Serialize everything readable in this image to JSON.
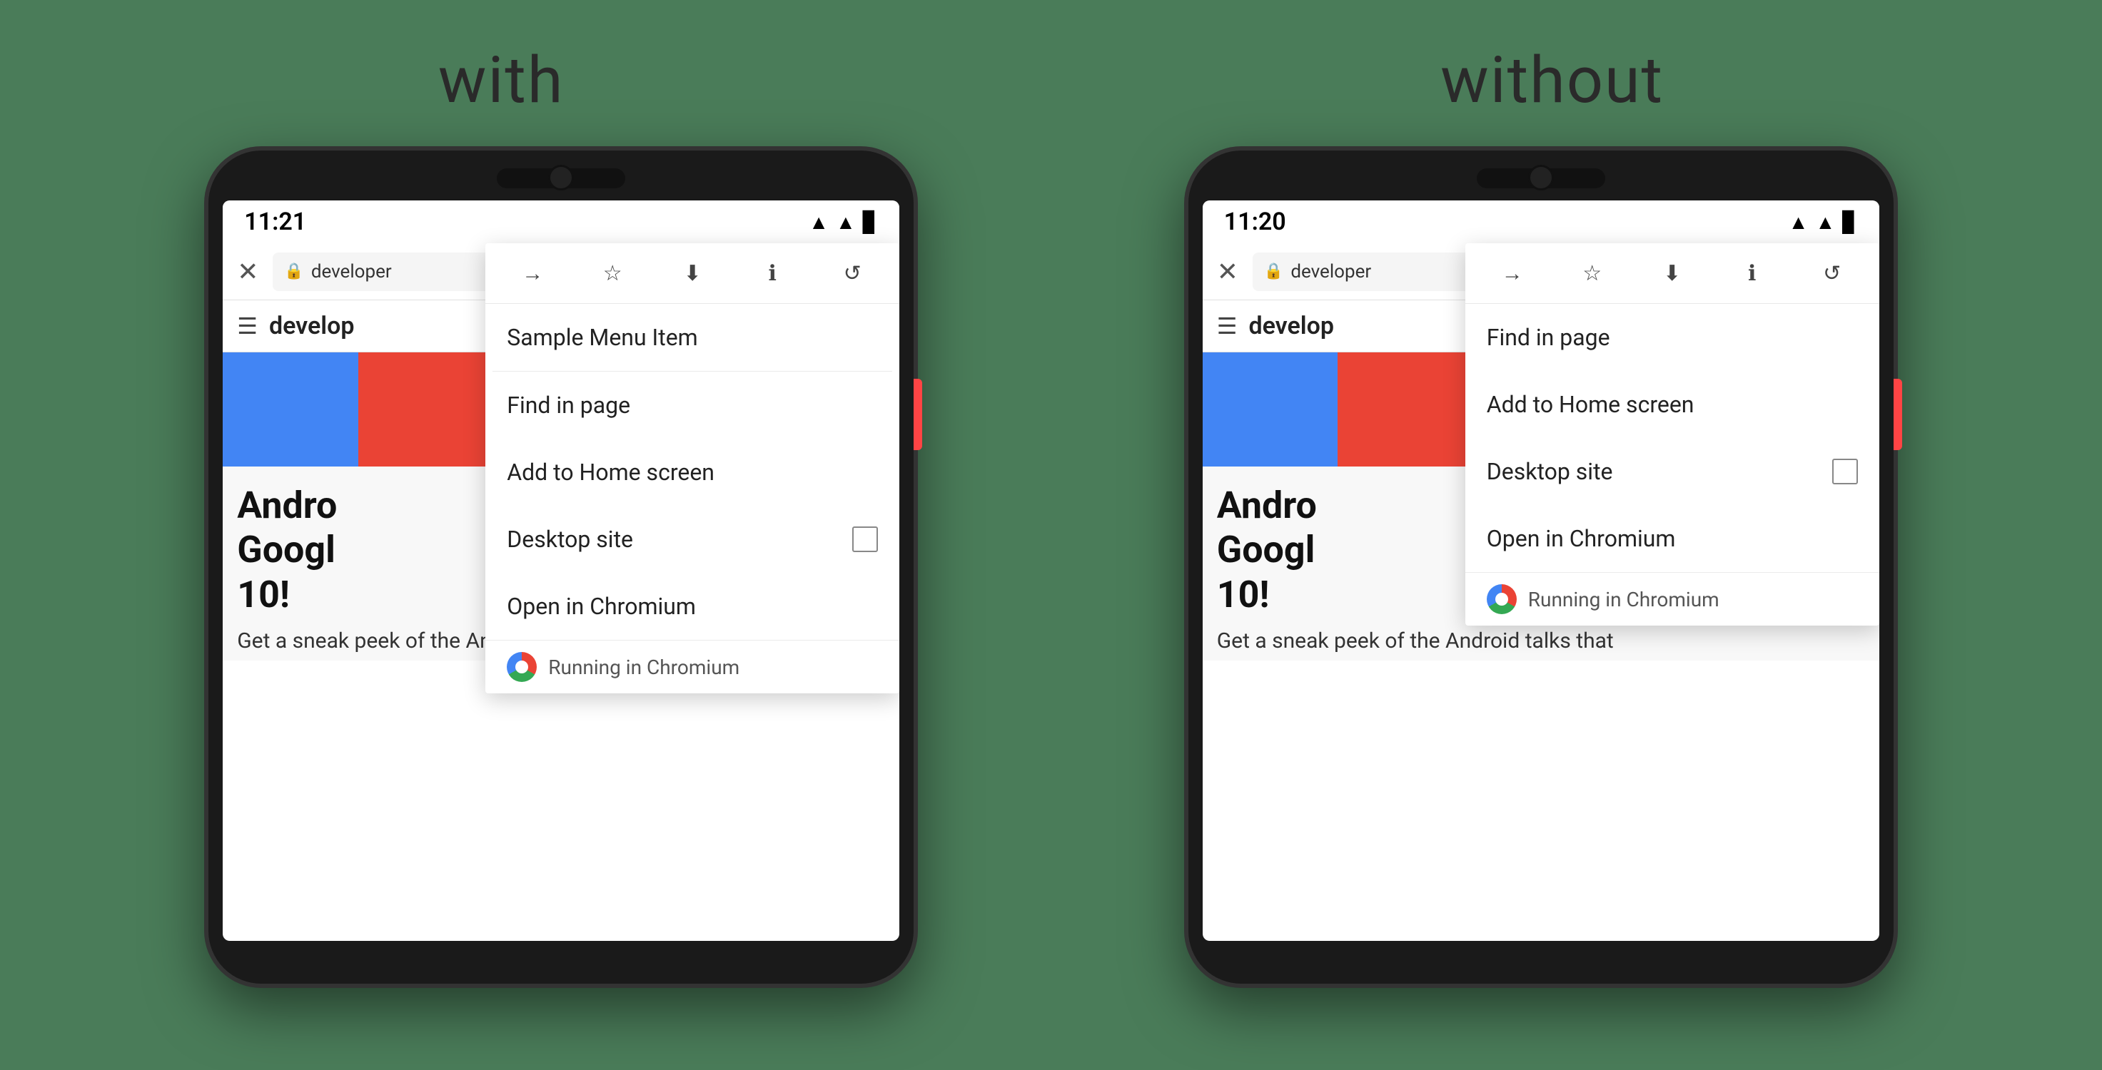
{
  "background_color": "#4a7c59",
  "labels": {
    "left": "with",
    "right": "without"
  },
  "left_phone": {
    "status_time": "11:21",
    "url_text": "developer",
    "site_title": "develop",
    "color_bars": [
      "#4285f4",
      "#ea4335",
      "#34a853",
      "#fbbc04",
      "#1a1a1a"
    ],
    "headline_line1": "Andro",
    "headline_line2": "Googl",
    "headline_line3": "10!",
    "subtext": "Get a sneak peek of the Android talks that",
    "dropdown": {
      "icons": [
        "→",
        "☆",
        "⬇",
        "ℹ",
        "↺"
      ],
      "items": [
        {
          "label": "Sample Menu Item",
          "extra": ""
        },
        {
          "divider": true
        },
        {
          "label": "Find in page",
          "extra": ""
        },
        {
          "label": "Add to Home screen",
          "extra": ""
        },
        {
          "label": "Desktop site",
          "extra": "checkbox"
        },
        {
          "label": "Open in Chromium",
          "extra": ""
        }
      ],
      "footer": "Running in Chromium"
    }
  },
  "right_phone": {
    "status_time": "11:20",
    "url_text": "developer",
    "site_title": "develop",
    "color_bars": [
      "#4285f4",
      "#ea4335",
      "#34a853",
      "#fbbc04",
      "#1a1a1a"
    ],
    "headline_line1": "Andro",
    "headline_line2": "Googl",
    "headline_line3": "10!",
    "subtext": "Get a sneak peek of the Android talks that",
    "dropdown": {
      "icons": [
        "→",
        "☆",
        "⬇",
        "ℹ",
        "↺"
      ],
      "items": [
        {
          "label": "Find in page",
          "extra": ""
        },
        {
          "label": "Add to Home screen",
          "extra": ""
        },
        {
          "label": "Desktop site",
          "extra": "checkbox"
        },
        {
          "label": "Open in Chromium",
          "extra": ""
        }
      ],
      "footer": "Running in Chromium"
    }
  }
}
